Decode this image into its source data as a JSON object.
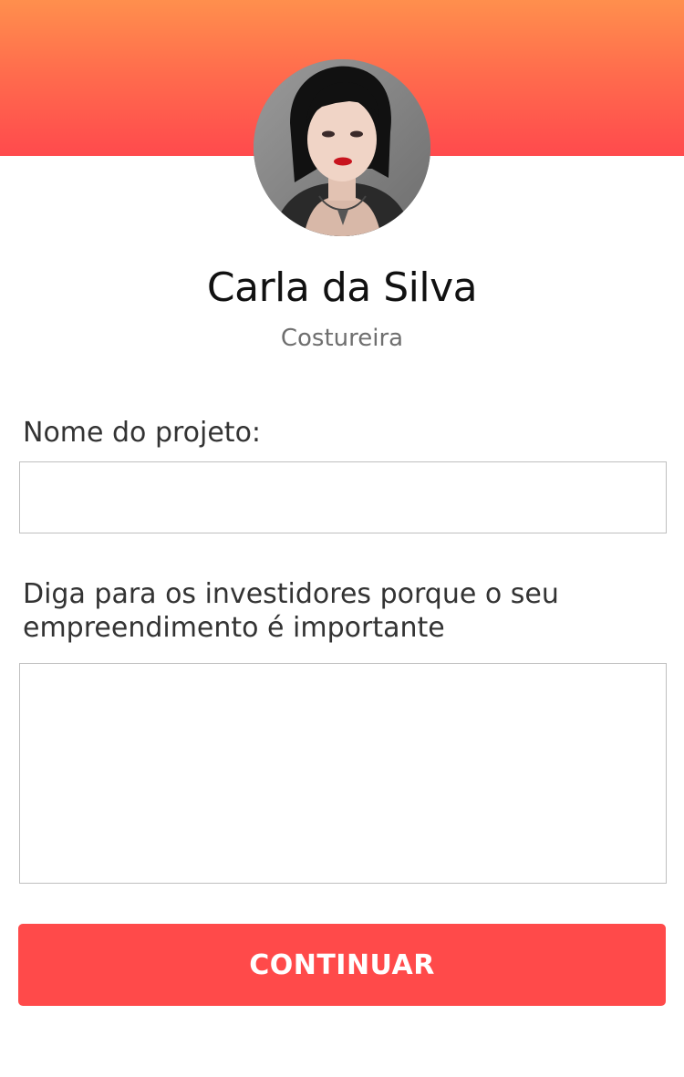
{
  "colors": {
    "header_gradient_top": "#ff8f4d",
    "header_gradient_bottom": "#ff4a4d",
    "button_background": "#ff4a4a",
    "button_text": "#ffffff"
  },
  "profile": {
    "name": "Carla da Silva",
    "role": "Costureira",
    "avatar_icon": "profile-photo"
  },
  "form": {
    "project_name": {
      "label": "Nome do projeto:",
      "value": "",
      "placeholder": ""
    },
    "pitch": {
      "label": "Diga para os investidores porque o seu empreendimento é importante",
      "value": "",
      "placeholder": ""
    },
    "continue_label": "CONTINUAR"
  }
}
